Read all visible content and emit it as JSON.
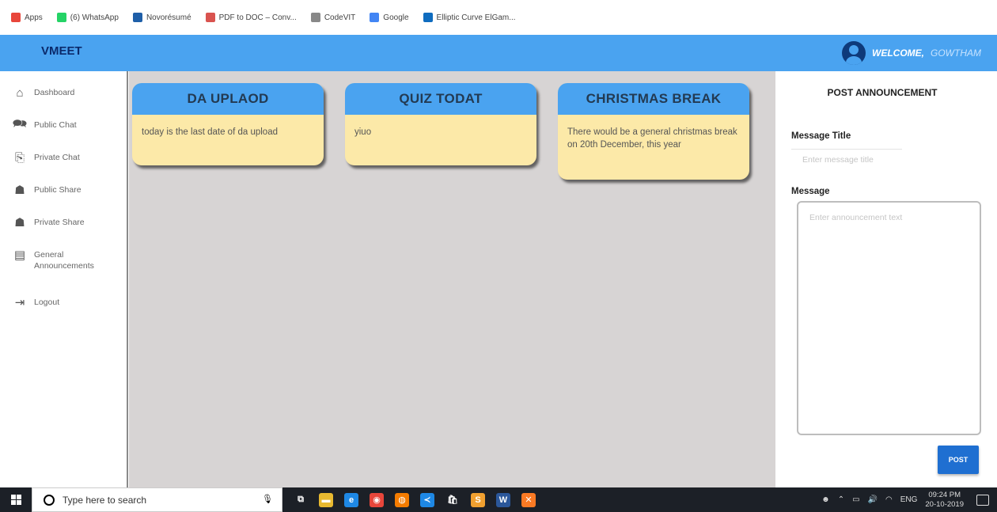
{
  "bookmarks": [
    {
      "label": "Apps",
      "icon": "apps-grid-icon",
      "color": "#e8463b"
    },
    {
      "label": "(6) WhatsApp",
      "icon": "whatsapp-icon",
      "color": "#25d366"
    },
    {
      "label": "Novorésumé",
      "icon": "novoresume-icon",
      "color": "#1f5fa8"
    },
    {
      "label": "PDF to DOC – Conv...",
      "icon": "pdf-doc-icon",
      "color": "#d9534f"
    },
    {
      "label": "CodeVIT",
      "icon": "code-icon",
      "color": "#888888"
    },
    {
      "label": "Google",
      "icon": "google-icon",
      "color": "#4285f4"
    },
    {
      "label": "Elliptic Curve ElGam...",
      "icon": "elliptic-icon",
      "color": "#0f6cbf"
    }
  ],
  "header": {
    "brand": "VMEET",
    "welcome": "WELCOME,",
    "username": "GOWTHAM",
    "color": "#4aa3f0"
  },
  "sidebar": {
    "items": [
      {
        "label": "Dashboard",
        "icon": "dashboard-icon",
        "glyph": "⌂"
      },
      {
        "label": "Public Chat",
        "icon": "public-chat-icon",
        "glyph": "🗪"
      },
      {
        "label": "Private Chat",
        "icon": "private-chat-icon",
        "glyph": "⎘"
      },
      {
        "label": "Public Share",
        "icon": "public-share-icon",
        "glyph": "☗"
      },
      {
        "label": "Private Share",
        "icon": "private-share-icon",
        "glyph": "☗"
      },
      {
        "label": "General Announcements",
        "icon": "announcements-log-icon",
        "glyph": "▤"
      },
      {
        "label": "Logout",
        "icon": "logout-icon",
        "glyph": "⇥"
      }
    ]
  },
  "announcements": [
    {
      "title": "DA UPLAOD",
      "body": "today is the last date of da upload"
    },
    {
      "title": "QUIZ TODAT",
      "body": "yiuo"
    },
    {
      "title": "CHRISTMAS BREAK",
      "body": "There would be a general christmas break on 20th December, this year"
    }
  ],
  "post_panel": {
    "heading": "POST ANNOUNCEMENT",
    "title_label": "Message Title",
    "title_placeholder": "Enter message title",
    "message_label": "Message",
    "message_placeholder": "Enter announcement text",
    "post_button": "POST",
    "accent": "#1f6fd1"
  },
  "taskbar": {
    "search_placeholder": "Type here to search",
    "apps": [
      {
        "icon": "task-view-icon",
        "color": "#1c2027",
        "glyph": "⧉"
      },
      {
        "icon": "file-explorer-icon",
        "color": "#e8b930",
        "glyph": "▬"
      },
      {
        "icon": "edge-icon",
        "color": "#1e88e5",
        "glyph": "e"
      },
      {
        "icon": "chrome-icon",
        "color": "#e8463b",
        "glyph": "◉"
      },
      {
        "icon": "firefox-icon",
        "color": "#f57c00",
        "glyph": "◍"
      },
      {
        "icon": "vscode-icon",
        "color": "#1e88e5",
        "glyph": "≺"
      },
      {
        "icon": "store-icon",
        "color": "#1c2027",
        "glyph": "🛍"
      },
      {
        "icon": "sublime-icon",
        "color": "#f0a030",
        "glyph": "S"
      },
      {
        "icon": "word-icon",
        "color": "#2b579a",
        "glyph": "W"
      },
      {
        "icon": "xampp-icon",
        "color": "#fb7a24",
        "glyph": "✕"
      }
    ],
    "language": "ENG",
    "time": "09:24 PM",
    "date": "20-10-2019"
  }
}
